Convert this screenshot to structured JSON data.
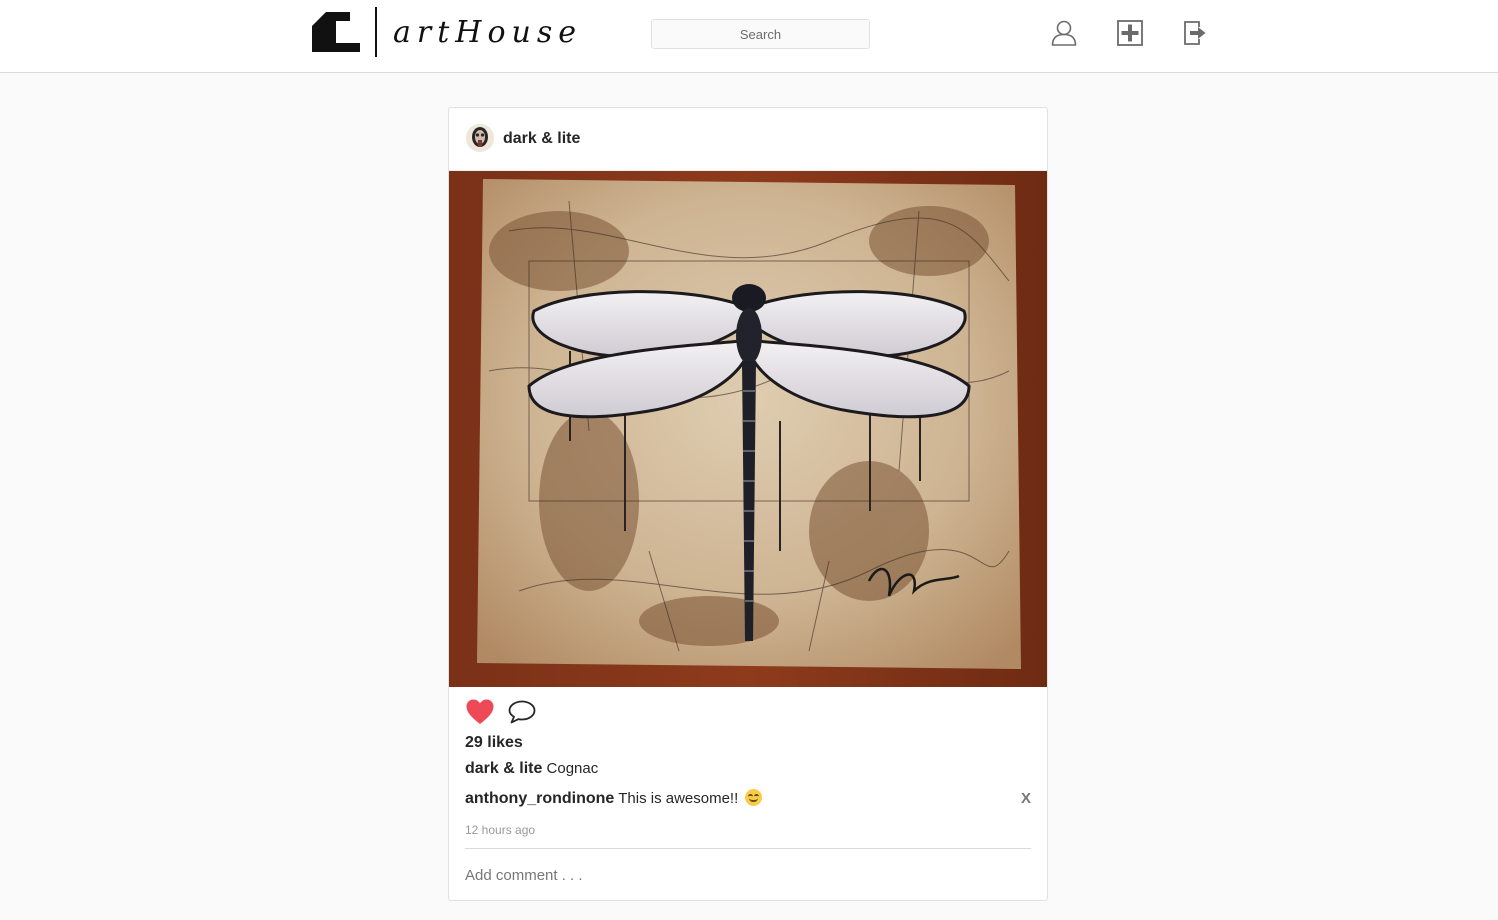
{
  "header": {
    "brand": "artHouse",
    "search": {
      "placeholder": "Search",
      "value": ""
    },
    "icons": [
      "profile-icon",
      "new-post-icon",
      "logout-icon"
    ]
  },
  "post": {
    "author": "dark & lite",
    "likes_text": "29 likes",
    "liked": true,
    "caption": {
      "user": "dark & lite",
      "text": "Cognac"
    },
    "comments": [
      {
        "user": "anthony_rondinone",
        "text": "This is awesome!!",
        "emoji": "smiling-face-emoji",
        "delete_label": "X"
      }
    ],
    "timestamp": "12 hours ago",
    "add_comment_placeholder": "Add comment . . ."
  },
  "colors": {
    "heart": "#ed4956",
    "text": "#262626",
    "muted": "#999999",
    "background": "#fafafa"
  }
}
